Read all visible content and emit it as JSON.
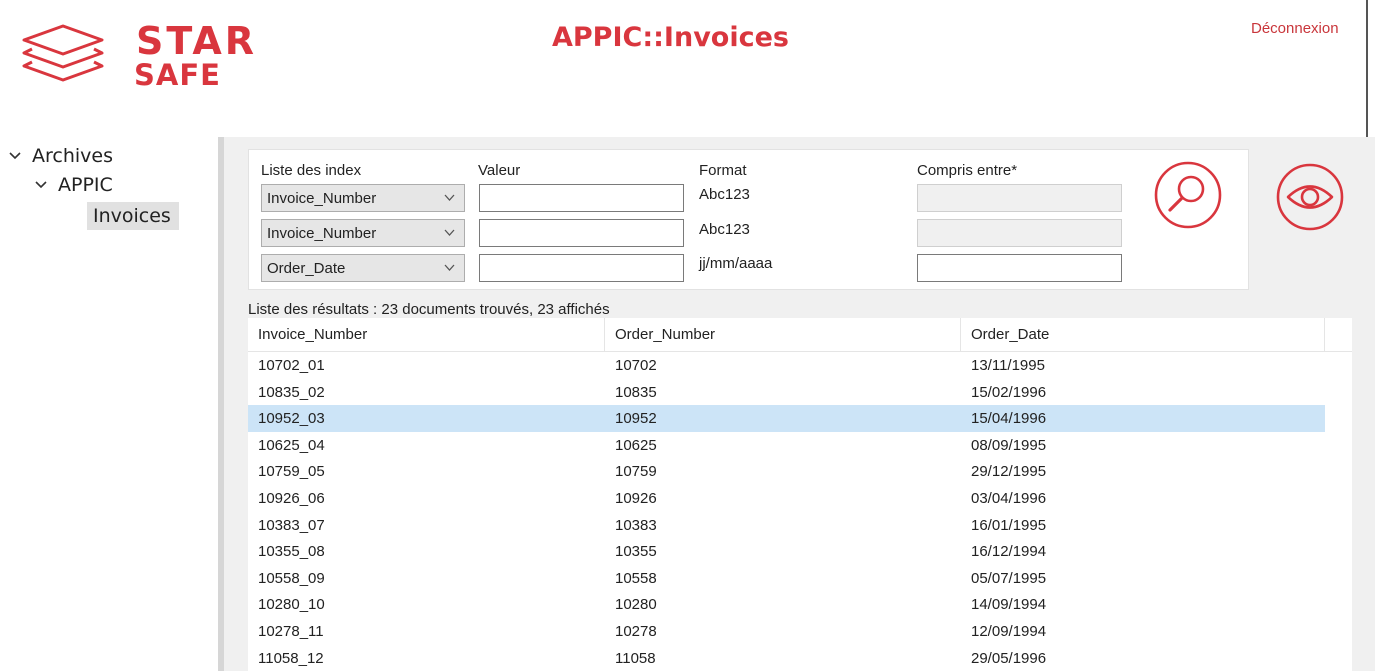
{
  "brand": {
    "word1": "STAR",
    "word2": "SAFE",
    "color": "#d9363e"
  },
  "header": {
    "title": "APPIC::Invoices",
    "logout_label": "Déconnexion"
  },
  "tree": {
    "root": "Archives",
    "child": "APPIC",
    "leaf": "Invoices"
  },
  "search": {
    "index_header": "Liste des index",
    "value_header": "Valeur",
    "format_header": "Format",
    "between_header": "Compris entre*",
    "rows": [
      {
        "index": "Invoice_Number",
        "value": "",
        "format": "Abc123",
        "between": "",
        "between_enabled": false
      },
      {
        "index": "Invoice_Number",
        "value": "",
        "format": "Abc123",
        "between": "",
        "between_enabled": false
      },
      {
        "index": "Order_Date",
        "value": "",
        "format": "jj/mm/aaaa",
        "between": "",
        "between_enabled": true
      }
    ],
    "search_icon": "search-icon",
    "view_icon": "eye-icon"
  },
  "results": {
    "summary": "Liste des résultats : 23 documents trouvés, 23 affichés",
    "columns": [
      "Invoice_Number",
      "Order_Number",
      "Order_Date"
    ],
    "selected_index": 2,
    "rows": [
      [
        "10702_01",
        "10702",
        "13/11/1995"
      ],
      [
        "10835_02",
        "10835",
        "15/02/1996"
      ],
      [
        "10952_03",
        "10952",
        "15/04/1996"
      ],
      [
        "10625_04",
        "10625",
        "08/09/1995"
      ],
      [
        "10759_05",
        "10759",
        "29/12/1995"
      ],
      [
        "10926_06",
        "10926",
        "03/04/1996"
      ],
      [
        "10383_07",
        "10383",
        "16/01/1995"
      ],
      [
        "10355_08",
        "10355",
        "16/12/1994"
      ],
      [
        "10558_09",
        "10558",
        "05/07/1995"
      ],
      [
        "10280_10",
        "10280",
        "14/09/1994"
      ],
      [
        "10278_11",
        "10278",
        "12/09/1994"
      ],
      [
        "11058_12",
        "11058",
        "29/05/1996"
      ]
    ]
  }
}
